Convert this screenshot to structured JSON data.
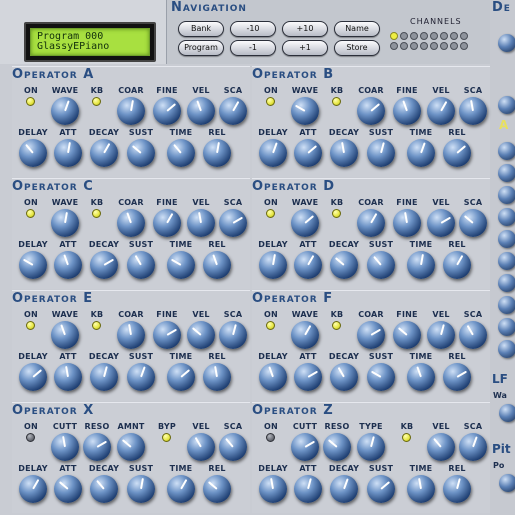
{
  "lcd": {
    "line1": "Program 000",
    "line2": "GlassyEPiano"
  },
  "navigation": {
    "title": "Navigation",
    "buttons": [
      "Bank",
      "-10",
      "+10",
      "Name",
      "Program",
      "-1",
      "+1",
      "Store"
    ],
    "channels_label": "Channels"
  },
  "right_edge": {
    "title_fragment": "De",
    "lf_fragment": "LF",
    "pit_fragment": "Pit",
    "a_fragment": "A",
    "wa_fragment": "Wa",
    "pol_fragment": "Po"
  },
  "operators": [
    {
      "name": "Operator A",
      "row1": [
        "On",
        "Wave",
        "Kb",
        "Coar",
        "Fine",
        "Vel",
        "Sca"
      ],
      "row2": [
        "Delay",
        "Att",
        "Decay",
        "Sust",
        "Time",
        "Rel"
      ],
      "led_on": [
        true,
        true
      ],
      "filter": false
    },
    {
      "name": "Operator B",
      "row1": [
        "On",
        "Wave",
        "Kb",
        "Coar",
        "Fine",
        "Vel",
        "Sca"
      ],
      "row2": [
        "Delay",
        "Att",
        "Decay",
        "Sust",
        "Time",
        "Rel"
      ],
      "led_on": [
        true,
        true
      ],
      "filter": false
    },
    {
      "name": "Operator C",
      "row1": [
        "On",
        "Wave",
        "Kb",
        "Coar",
        "Fine",
        "Vel",
        "Sca"
      ],
      "row2": [
        "Delay",
        "Att",
        "Decay",
        "Sust",
        "Time",
        "Rel"
      ],
      "led_on": [
        true,
        true
      ],
      "filter": false
    },
    {
      "name": "Operator D",
      "row1": [
        "On",
        "Wave",
        "Kb",
        "Coar",
        "Fine",
        "Vel",
        "Sca"
      ],
      "row2": [
        "Delay",
        "Att",
        "Decay",
        "Sust",
        "Time",
        "Rel"
      ],
      "led_on": [
        true,
        true
      ],
      "filter": false
    },
    {
      "name": "Operator E",
      "row1": [
        "On",
        "Wave",
        "Kb",
        "Coar",
        "Fine",
        "Vel",
        "Sca"
      ],
      "row2": [
        "Delay",
        "Att",
        "Decay",
        "Sust",
        "Time",
        "Rel"
      ],
      "led_on": [
        true,
        true
      ],
      "filter": false
    },
    {
      "name": "Operator F",
      "row1": [
        "On",
        "Wave",
        "Kb",
        "Coar",
        "Fine",
        "Vel",
        "Sca"
      ],
      "row2": [
        "Delay",
        "Att",
        "Decay",
        "Sust",
        "Time",
        "Rel"
      ],
      "led_on": [
        true,
        true
      ],
      "filter": false
    },
    {
      "name": "Operator X",
      "row1": [
        "On",
        "Cutt",
        "Reso",
        "Amnt",
        "Byp",
        "Vel",
        "Sca"
      ],
      "row2": [
        "Delay",
        "Att",
        "Decay",
        "Sust",
        "Time",
        "Rel"
      ],
      "led_on": [
        false,
        true
      ],
      "filter": "x"
    },
    {
      "name": "Operator Z",
      "row1": [
        "On",
        "Cutt",
        "Reso",
        "Type",
        "Kb",
        "Vel",
        "Sca"
      ],
      "row2": [
        "Delay",
        "Att",
        "Decay",
        "Sust",
        "Time",
        "Rel"
      ],
      "led_on": [
        false,
        true
      ],
      "filter": "z"
    }
  ],
  "colors": {
    "accent": "#2a4e82",
    "lcd": "#a8e040",
    "led_on": "#e6e640",
    "knob": "#3a5f94"
  }
}
